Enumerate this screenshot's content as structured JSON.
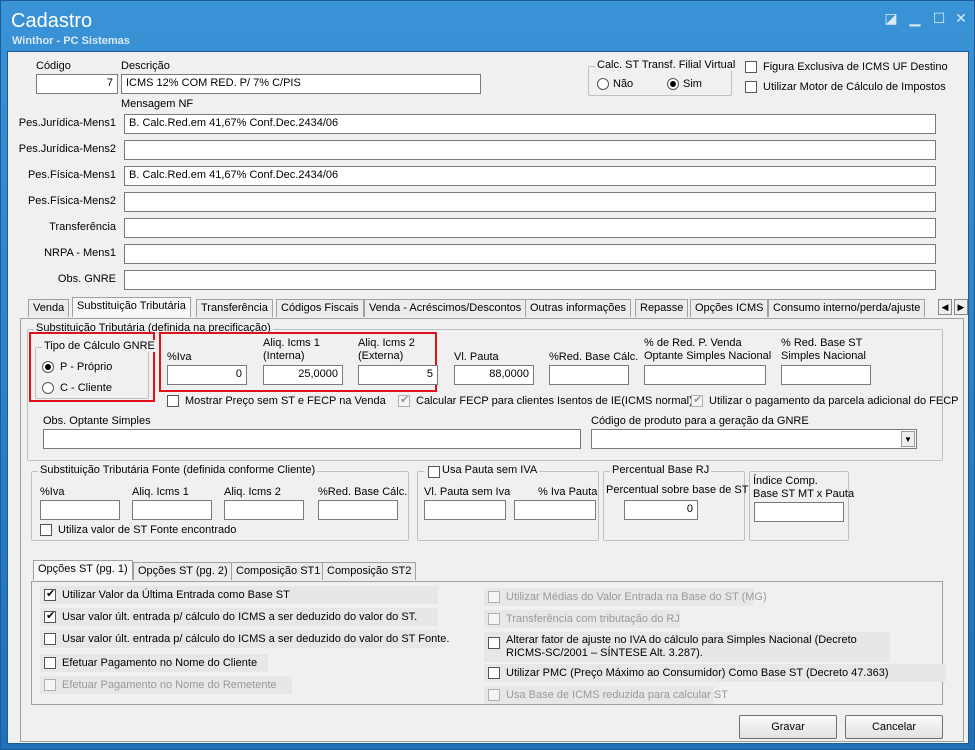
{
  "window": {
    "title": "Cadastro",
    "subtitle": "Winthor - PC Sistemas"
  },
  "header": {
    "codigo_label": "Código",
    "codigo_value": "7",
    "descricao_label": "Descrição",
    "descricao_value": "ICMS 12% COM RED. P/ 7% C/PIS",
    "calc_st_label": "Calc. ST Transf. Filial Virtual",
    "nao_label": "Não",
    "sim_label": "Sim",
    "figura_label": "Figura Exclusiva de ICMS UF Destino",
    "motor_label": "Utilizar Motor de Cálculo de Impostos",
    "mensagem_label": "Mensagem NF"
  },
  "messages": [
    {
      "label": "Pes.Jurídica-Mens1",
      "value": "B. Calc.Red.em 41,67% Conf.Dec.2434/06"
    },
    {
      "label": "Pes.Jurídica-Mens2",
      "value": ""
    },
    {
      "label": "Pes.Física-Mens1",
      "value": "B. Calc.Red.em 41,67% Conf.Dec.2434/06"
    },
    {
      "label": "Pes.Física-Mens2",
      "value": ""
    },
    {
      "label": "Transferência",
      "value": ""
    },
    {
      "label": "NRPA - Mens1",
      "value": ""
    },
    {
      "label": "Obs. GNRE",
      "value": ""
    }
  ],
  "tabs": [
    "Venda",
    "Substituição Tributária",
    "Transferência",
    "Códigos Fiscais",
    "Venda - Acréscimos/Descontos",
    "Outras informações",
    "Repasse",
    "Opções ICMS",
    "Consumo interno/perda/ajuste"
  ],
  "st": {
    "group_label": "Substituição Tributária (definida na precificação)",
    "tipo_label": "Tipo de Cálculo GNRE",
    "proprio_label": "P - Próprio",
    "cliente_label": "C - Cliente",
    "iva_label": "%Iva",
    "iva_value": "0",
    "aliq1_label1": "Aliq. Icms 1",
    "aliq1_label2": "(Interna)",
    "aliq1_value": "25,0000",
    "aliq2_label1": "Aliq. Icms 2",
    "aliq2_label2": "(Externa)",
    "aliq2_value": "5",
    "pauta_label": "Vl. Pauta",
    "pauta_value": "88,0000",
    "redbase_label": "%Red. Base Cálc.",
    "redbase_value": "",
    "redvenda_label1": "% de Red. P. Venda",
    "redvenda_label2": "Optante Simples Nacional",
    "redsn_label1": "% Red. Base ST",
    "redsn_label2": "Simples Nacional",
    "mostrar_label": "Mostrar Preço sem ST e FECP na Venda",
    "fecp_label": "Calcular FECP para clientes Isentos de IE(ICMS normal)",
    "parcela_label": "Utilizar o pagamento da parcela adicional do FECP",
    "obs_label": "Obs. Optante Simples",
    "codprod_label": "Código de produto para a geração da GNRE"
  },
  "fonte": {
    "group_label": "Substituição Tributária Fonte (definida conforme Cliente)",
    "iva_label": "%Iva",
    "aliq1_label": "Aliq. Icms 1",
    "aliq2_label": "Aliq. Icms 2",
    "red_label": "%Red. Base Cálc.",
    "utiliza_label": "Utiliza valor de ST Fonte encontrado",
    "pauta_group_label": "Usa Pauta sem IVA",
    "pauta_label": "Vl. Pauta sem Iva",
    "ivapauta_label": "% Iva Pauta",
    "rj_group_label": "Percentual Base RJ",
    "rj_label": "Percentual sobre base de ST",
    "rj_value": "0",
    "indice_label1": "Índice Comp.",
    "indice_label2": "Base ST MT x Pauta"
  },
  "subtabs": [
    "Opções ST (pg. 1)",
    "Opções ST (pg. 2)",
    "Composição ST1",
    "Composição ST2"
  ],
  "options_left": [
    {
      "label": "Utilizar Valor da Última Entrada como Base ST",
      "checked": true,
      "enabled": true
    },
    {
      "label": "Usar valor últ. entrada p/ cálculo do ICMS a ser deduzido do valor do ST.",
      "checked": true,
      "enabled": true
    },
    {
      "label": "Usar valor últ. entrada p/ cálculo do ICMS a ser deduzido do valor do ST Fonte.",
      "checked": false,
      "enabled": true
    },
    {
      "label": "Efetuar Pagamento no Nome do Cliente",
      "checked": false,
      "enabled": true
    },
    {
      "label": "Efetuar Pagamento no Nome do Remetente",
      "checked": false,
      "enabled": false
    }
  ],
  "options_right": [
    {
      "label": "Utilizar Médias do Valor Entrada na Base do ST (MG)",
      "checked": false,
      "enabled": false
    },
    {
      "label": "Transferência com tributação do RJ",
      "checked": false,
      "enabled": false
    },
    {
      "label1": "Alterar fator de ajuste no IVA do cálculo para Simples Nacional (Decreto",
      "label2": "RICMS-SC/2001 – SÍNTESE Alt. 3.287).",
      "checked": false,
      "enabled": true
    },
    {
      "label": "Utilizar PMC (Preço Máximo ao Consumidor) Como Base ST (Decreto 47.363)",
      "checked": false,
      "enabled": true
    },
    {
      "label": "Usa Base de ICMS reduzida para calcular ST",
      "checked": false,
      "enabled": false
    }
  ],
  "buttons": {
    "gravar": "Gravar",
    "cancelar": "Cancelar"
  }
}
